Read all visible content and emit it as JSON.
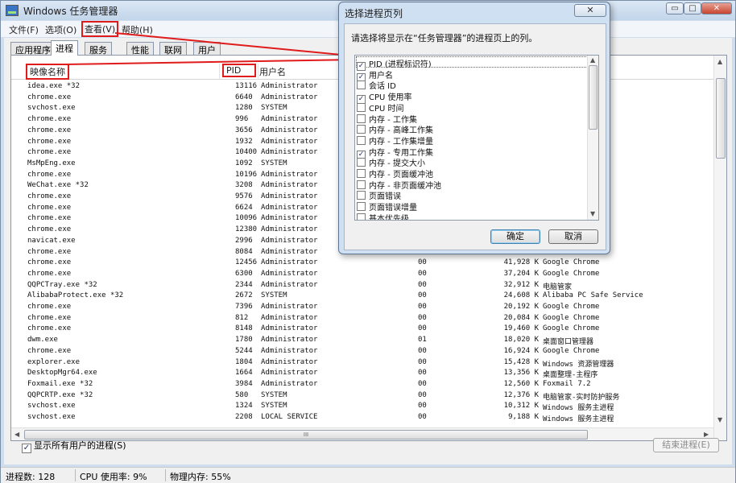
{
  "window": {
    "title": "Windows 任务管理器",
    "caption_buttons": [
      "▭",
      "□",
      "✕"
    ]
  },
  "menu": {
    "file": "文件(F)",
    "options": "选项(O)",
    "view": "查看(V)",
    "help": "帮助(H)"
  },
  "tabs": [
    "应用程序",
    "进程",
    "服务",
    "性能",
    "联网",
    "用户"
  ],
  "active_tab": "进程",
  "columns": {
    "image_name": "映像名称",
    "pid": "PID",
    "user": "用户名"
  },
  "processes": [
    {
      "name": "idea.exe *32",
      "pid": "13116",
      "user": "Administrator",
      "cpu": "",
      "mem": "",
      "desc": ""
    },
    {
      "name": "chrome.exe",
      "pid": "6640",
      "user": "Administrator",
      "cpu": "",
      "mem": "",
      "desc": ""
    },
    {
      "name": "svchost.exe",
      "pid": "1280",
      "user": "SYSTEM",
      "cpu": "",
      "mem": "",
      "desc": "程"
    },
    {
      "name": "chrome.exe",
      "pid": "996",
      "user": "Administrator",
      "cpu": "",
      "mem": "",
      "desc": ""
    },
    {
      "name": "chrome.exe",
      "pid": "3656",
      "user": "Administrator",
      "cpu": "",
      "mem": "",
      "desc": ""
    },
    {
      "name": "chrome.exe",
      "pid": "1932",
      "user": "Administrator",
      "cpu": "",
      "mem": "",
      "desc": ""
    },
    {
      "name": "chrome.exe",
      "pid": "10400",
      "user": "Administrator",
      "cpu": "",
      "mem": "",
      "desc": ""
    },
    {
      "name": "MsMpEng.exe",
      "pid": "1092",
      "user": "SYSTEM",
      "cpu": "",
      "mem": "",
      "desc": "ce Executable"
    },
    {
      "name": "chrome.exe",
      "pid": "10196",
      "user": "Administrator",
      "cpu": "",
      "mem": "",
      "desc": ""
    },
    {
      "name": "WeChat.exe *32",
      "pid": "3208",
      "user": "Administrator",
      "cpu": "",
      "mem": "",
      "desc": ""
    },
    {
      "name": "chrome.exe",
      "pid": "9576",
      "user": "Administrator",
      "cpu": "",
      "mem": "",
      "desc": ""
    },
    {
      "name": "chrome.exe",
      "pid": "6624",
      "user": "Administrator",
      "cpu": "",
      "mem": "",
      "desc": ""
    },
    {
      "name": "chrome.exe",
      "pid": "10096",
      "user": "Administrator",
      "cpu": "",
      "mem": "",
      "desc": ""
    },
    {
      "name": "chrome.exe",
      "pid": "12380",
      "user": "Administrator",
      "cpu": "",
      "mem": "",
      "desc": ""
    },
    {
      "name": "navicat.exe",
      "pid": "2996",
      "user": "Administrator",
      "cpu": "",
      "mem": "",
      "desc": ""
    },
    {
      "name": "chrome.exe",
      "pid": "8084",
      "user": "Administrator",
      "cpu": "00",
      "mem": "",
      "desc": ""
    },
    {
      "name": "chrome.exe",
      "pid": "12456",
      "user": "Administrator",
      "cpu": "00",
      "mem": "41,928 K",
      "desc": "Google Chrome"
    },
    {
      "name": "chrome.exe",
      "pid": "6300",
      "user": "Administrator",
      "cpu": "00",
      "mem": "37,204 K",
      "desc": "Google Chrome"
    },
    {
      "name": "QQPCTray.exe *32",
      "pid": "2344",
      "user": "Administrator",
      "cpu": "00",
      "mem": "32,912 K",
      "desc": "电脑管家"
    },
    {
      "name": "AlibabaProtect.exe *32",
      "pid": "2672",
      "user": "SYSTEM",
      "cpu": "00",
      "mem": "24,608 K",
      "desc": "Alibaba PC Safe Service"
    },
    {
      "name": "chrome.exe",
      "pid": "7396",
      "user": "Administrator",
      "cpu": "00",
      "mem": "20,192 K",
      "desc": "Google Chrome"
    },
    {
      "name": "chrome.exe",
      "pid": "812",
      "user": "Administrator",
      "cpu": "00",
      "mem": "20,084 K",
      "desc": "Google Chrome"
    },
    {
      "name": "chrome.exe",
      "pid": "8148",
      "user": "Administrator",
      "cpu": "00",
      "mem": "19,460 K",
      "desc": "Google Chrome"
    },
    {
      "name": "dwm.exe",
      "pid": "1780",
      "user": "Administrator",
      "cpu": "01",
      "mem": "18,020 K",
      "desc": "桌面窗口管理器"
    },
    {
      "name": "chrome.exe",
      "pid": "5244",
      "user": "Administrator",
      "cpu": "00",
      "mem": "16,924 K",
      "desc": "Google Chrome"
    },
    {
      "name": "explorer.exe",
      "pid": "1804",
      "user": "Administrator",
      "cpu": "00",
      "mem": "15,428 K",
      "desc": "Windows 资源管理器"
    },
    {
      "name": "DesktopMgr64.exe",
      "pid": "1664",
      "user": "Administrator",
      "cpu": "00",
      "mem": "13,356 K",
      "desc": "桌面整理-主程序"
    },
    {
      "name": "Foxmail.exe *32",
      "pid": "3984",
      "user": "Administrator",
      "cpu": "00",
      "mem": "12,560 K",
      "desc": "Foxmail 7.2"
    },
    {
      "name": "QQPCRTP.exe *32",
      "pid": "580",
      "user": "SYSTEM",
      "cpu": "00",
      "mem": "12,376 K",
      "desc": "电脑管家-实时防护服务"
    },
    {
      "name": "svchost.exe",
      "pid": "1324",
      "user": "SYSTEM",
      "cpu": "00",
      "mem": "10,312 K",
      "desc": "Windows 服务主进程"
    },
    {
      "name": "svchost.exe",
      "pid": "2208",
      "user": "LOCAL SERVICE",
      "cpu": "00",
      "mem": "9,188 K",
      "desc": "Windows 服务主进程"
    }
  ],
  "show_all_users": {
    "label": "显示所有用户的进程(S)",
    "checked": true
  },
  "end_process_label": "结束进程(E)",
  "hscroll_grip": "III",
  "status": {
    "processes": "进程数: 128",
    "cpu": "CPU 使用率: 9%",
    "memory": "物理内存: 55%"
  },
  "dialog": {
    "title": "选择进程页列",
    "close_label": "✕",
    "prompt": "请选择将显示在“任务管理器”的进程页上的列。",
    "options": [
      {
        "label": "PID (进程标识符)",
        "checked": true
      },
      {
        "label": "用户名",
        "checked": true
      },
      {
        "label": "会话 ID",
        "checked": false
      },
      {
        "label": "CPU 使用率",
        "checked": true
      },
      {
        "label": "CPU 时间",
        "checked": false
      },
      {
        "label": "内存 - 工作集",
        "checked": false
      },
      {
        "label": "内存 - 高峰工作集",
        "checked": false
      },
      {
        "label": "内存 - 工作集增量",
        "checked": false
      },
      {
        "label": "内存 - 专用工作集",
        "checked": true
      },
      {
        "label": "内存 - 提交大小",
        "checked": false
      },
      {
        "label": "内存 - 页面缓冲池",
        "checked": false
      },
      {
        "label": "内存 - 非页面缓冲池",
        "checked": false
      },
      {
        "label": "页面错误",
        "checked": false
      },
      {
        "label": "页面错误增量",
        "checked": false
      },
      {
        "label": "基本优先级",
        "checked": false
      }
    ],
    "ok_label": "确定",
    "cancel_label": "取消"
  },
  "annotation_color": "#e01b1b"
}
